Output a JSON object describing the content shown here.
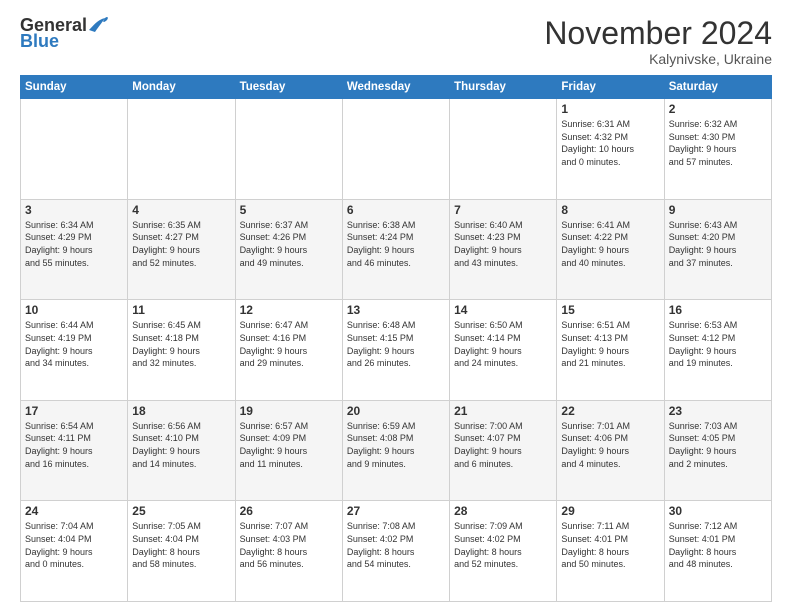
{
  "header": {
    "logo_general": "General",
    "logo_blue": "Blue",
    "title": "November 2024",
    "subtitle": "Kalynivske, Ukraine"
  },
  "days_of_week": [
    "Sunday",
    "Monday",
    "Tuesday",
    "Wednesday",
    "Thursday",
    "Friday",
    "Saturday"
  ],
  "weeks": [
    [
      {
        "day": "",
        "info": ""
      },
      {
        "day": "",
        "info": ""
      },
      {
        "day": "",
        "info": ""
      },
      {
        "day": "",
        "info": ""
      },
      {
        "day": "",
        "info": ""
      },
      {
        "day": "1",
        "info": "Sunrise: 6:31 AM\nSunset: 4:32 PM\nDaylight: 10 hours\nand 0 minutes."
      },
      {
        "day": "2",
        "info": "Sunrise: 6:32 AM\nSunset: 4:30 PM\nDaylight: 9 hours\nand 57 minutes."
      }
    ],
    [
      {
        "day": "3",
        "info": "Sunrise: 6:34 AM\nSunset: 4:29 PM\nDaylight: 9 hours\nand 55 minutes."
      },
      {
        "day": "4",
        "info": "Sunrise: 6:35 AM\nSunset: 4:27 PM\nDaylight: 9 hours\nand 52 minutes."
      },
      {
        "day": "5",
        "info": "Sunrise: 6:37 AM\nSunset: 4:26 PM\nDaylight: 9 hours\nand 49 minutes."
      },
      {
        "day": "6",
        "info": "Sunrise: 6:38 AM\nSunset: 4:24 PM\nDaylight: 9 hours\nand 46 minutes."
      },
      {
        "day": "7",
        "info": "Sunrise: 6:40 AM\nSunset: 4:23 PM\nDaylight: 9 hours\nand 43 minutes."
      },
      {
        "day": "8",
        "info": "Sunrise: 6:41 AM\nSunset: 4:22 PM\nDaylight: 9 hours\nand 40 minutes."
      },
      {
        "day": "9",
        "info": "Sunrise: 6:43 AM\nSunset: 4:20 PM\nDaylight: 9 hours\nand 37 minutes."
      }
    ],
    [
      {
        "day": "10",
        "info": "Sunrise: 6:44 AM\nSunset: 4:19 PM\nDaylight: 9 hours\nand 34 minutes."
      },
      {
        "day": "11",
        "info": "Sunrise: 6:45 AM\nSunset: 4:18 PM\nDaylight: 9 hours\nand 32 minutes."
      },
      {
        "day": "12",
        "info": "Sunrise: 6:47 AM\nSunset: 4:16 PM\nDaylight: 9 hours\nand 29 minutes."
      },
      {
        "day": "13",
        "info": "Sunrise: 6:48 AM\nSunset: 4:15 PM\nDaylight: 9 hours\nand 26 minutes."
      },
      {
        "day": "14",
        "info": "Sunrise: 6:50 AM\nSunset: 4:14 PM\nDaylight: 9 hours\nand 24 minutes."
      },
      {
        "day": "15",
        "info": "Sunrise: 6:51 AM\nSunset: 4:13 PM\nDaylight: 9 hours\nand 21 minutes."
      },
      {
        "day": "16",
        "info": "Sunrise: 6:53 AM\nSunset: 4:12 PM\nDaylight: 9 hours\nand 19 minutes."
      }
    ],
    [
      {
        "day": "17",
        "info": "Sunrise: 6:54 AM\nSunset: 4:11 PM\nDaylight: 9 hours\nand 16 minutes."
      },
      {
        "day": "18",
        "info": "Sunrise: 6:56 AM\nSunset: 4:10 PM\nDaylight: 9 hours\nand 14 minutes."
      },
      {
        "day": "19",
        "info": "Sunrise: 6:57 AM\nSunset: 4:09 PM\nDaylight: 9 hours\nand 11 minutes."
      },
      {
        "day": "20",
        "info": "Sunrise: 6:59 AM\nSunset: 4:08 PM\nDaylight: 9 hours\nand 9 minutes."
      },
      {
        "day": "21",
        "info": "Sunrise: 7:00 AM\nSunset: 4:07 PM\nDaylight: 9 hours\nand 6 minutes."
      },
      {
        "day": "22",
        "info": "Sunrise: 7:01 AM\nSunset: 4:06 PM\nDaylight: 9 hours\nand 4 minutes."
      },
      {
        "day": "23",
        "info": "Sunrise: 7:03 AM\nSunset: 4:05 PM\nDaylight: 9 hours\nand 2 minutes."
      }
    ],
    [
      {
        "day": "24",
        "info": "Sunrise: 7:04 AM\nSunset: 4:04 PM\nDaylight: 9 hours\nand 0 minutes."
      },
      {
        "day": "25",
        "info": "Sunrise: 7:05 AM\nSunset: 4:04 PM\nDaylight: 8 hours\nand 58 minutes."
      },
      {
        "day": "26",
        "info": "Sunrise: 7:07 AM\nSunset: 4:03 PM\nDaylight: 8 hours\nand 56 minutes."
      },
      {
        "day": "27",
        "info": "Sunrise: 7:08 AM\nSunset: 4:02 PM\nDaylight: 8 hours\nand 54 minutes."
      },
      {
        "day": "28",
        "info": "Sunrise: 7:09 AM\nSunset: 4:02 PM\nDaylight: 8 hours\nand 52 minutes."
      },
      {
        "day": "29",
        "info": "Sunrise: 7:11 AM\nSunset: 4:01 PM\nDaylight: 8 hours\nand 50 minutes."
      },
      {
        "day": "30",
        "info": "Sunrise: 7:12 AM\nSunset: 4:01 PM\nDaylight: 8 hours\nand 48 minutes."
      }
    ]
  ]
}
